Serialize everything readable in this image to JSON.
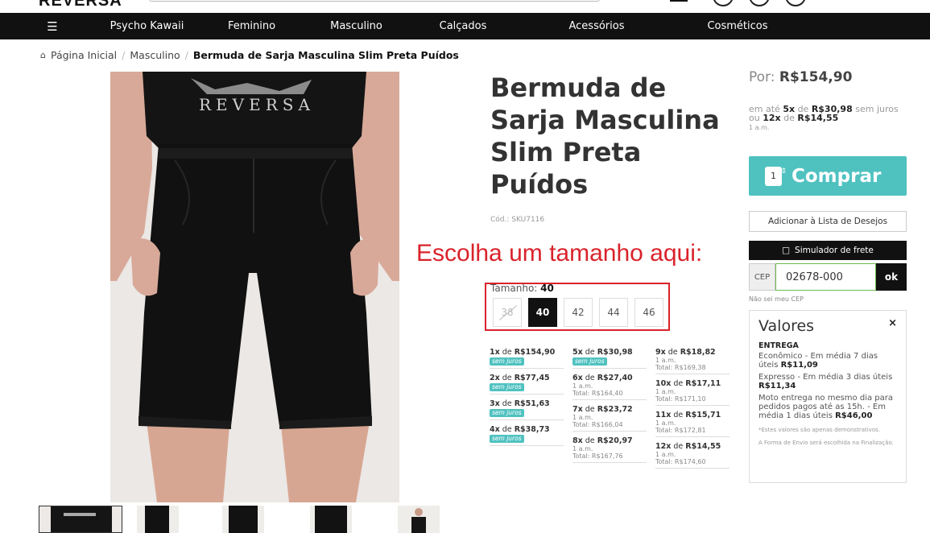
{
  "header": {
    "logo": "REVERSA"
  },
  "nav": {
    "items": [
      "Psycho Kawaii",
      "Feminino",
      "Masculino",
      "Calçados",
      "Acessórios",
      "Cosméticos"
    ]
  },
  "breadcrumb": {
    "home": "Página Inicial",
    "category": "Masculino",
    "current": "Bermuda de Sarja Masculina Slim Preta Puídos"
  },
  "product": {
    "title": "Bermuda de Sarja Masculina Slim Preta Puídos",
    "sku": "Cód.: SKU7116",
    "shirt_print": "REVERSA"
  },
  "annotation": "Escolha um tamanho aqui:",
  "sizes": {
    "label": "Tamanho:",
    "selected": "40",
    "options": [
      "38",
      "40",
      "42",
      "44",
      "46"
    ],
    "unavailable": [
      "38"
    ]
  },
  "installments": {
    "col1": [
      {
        "n": "1x",
        "de": "de",
        "val": "R$154,90",
        "badge": "sem juros"
      },
      {
        "n": "2x",
        "de": "de",
        "val": "R$77,45",
        "badge": "sem juros"
      },
      {
        "n": "3x",
        "de": "de",
        "val": "R$51,63",
        "badge": "sem juros"
      },
      {
        "n": "4x",
        "de": "de",
        "val": "R$38,73",
        "badge": "sem juros"
      }
    ],
    "col2": [
      {
        "n": "5x",
        "de": "de",
        "val": "R$30,98",
        "badge": "sem juros"
      },
      {
        "n": "6x",
        "de": "de",
        "val": "R$27,40",
        "am": "1 a.m.",
        "total": "Total: R$164,40"
      },
      {
        "n": "7x",
        "de": "de",
        "val": "R$23,72",
        "am": "1 a.m.",
        "total": "Total: R$166,04"
      },
      {
        "n": "8x",
        "de": "de",
        "val": "R$20,97",
        "am": "1 a.m.",
        "total": "Total: R$167,76"
      }
    ],
    "col3": [
      {
        "n": "9x",
        "de": "de",
        "val": "R$18,82",
        "am": "1 a.m.",
        "total": "Total: R$169,38"
      },
      {
        "n": "10x",
        "de": "de",
        "val": "R$17,11",
        "am": "1 a.m.",
        "total": "Total: R$171,10"
      },
      {
        "n": "11x",
        "de": "de",
        "val": "R$15,71",
        "am": "1 a.m.",
        "total": "Total: R$172,81"
      },
      {
        "n": "12x",
        "de": "de",
        "val": "R$14,55",
        "am": "1 a.m.",
        "total": "Total: R$174,60"
      }
    ]
  },
  "price": {
    "por_label": "Por:",
    "value": "R$154,90",
    "line1_pre": "em até",
    "line1_n": "5x",
    "line1_de": "de",
    "line1_val": "R$30,98",
    "line1_post": "sem juros",
    "line2_pre": "ou",
    "line2_n": "12x",
    "line2_de": "de",
    "line2_val": "R$14,55",
    "line2_am": "1 a.m."
  },
  "buy": {
    "qty": "1",
    "label": "Comprar"
  },
  "wishlist": "Adicionar à Lista de Desejos",
  "shipping": {
    "button": "Simulador de frete",
    "cep_label": "CEP",
    "cep_value": "02678-000",
    "ok": "ok",
    "no_cep": "Não sei meu CEP"
  },
  "valores": {
    "title": "Valores",
    "close": "×",
    "section": "ENTREGA",
    "options": [
      {
        "text": "Econômico - Em média 7 dias úteis",
        "price": "R$11,09"
      },
      {
        "text": "Expresso - Em média 3 dias úteis",
        "price": "R$11,34"
      },
      {
        "text": "Moto entrega no mesmo dia para pedidos pagos até as 15h. - Em média 1 dias úteis",
        "price": "R$46,00"
      }
    ],
    "note1": "*Estes valores são apenas demonstrativos.",
    "note2": "A Forma de Envio será escolhida na Finalização."
  },
  "colors": {
    "accent": "#4fc2c0",
    "nav": "#111111",
    "annotation": "#d9232b"
  }
}
